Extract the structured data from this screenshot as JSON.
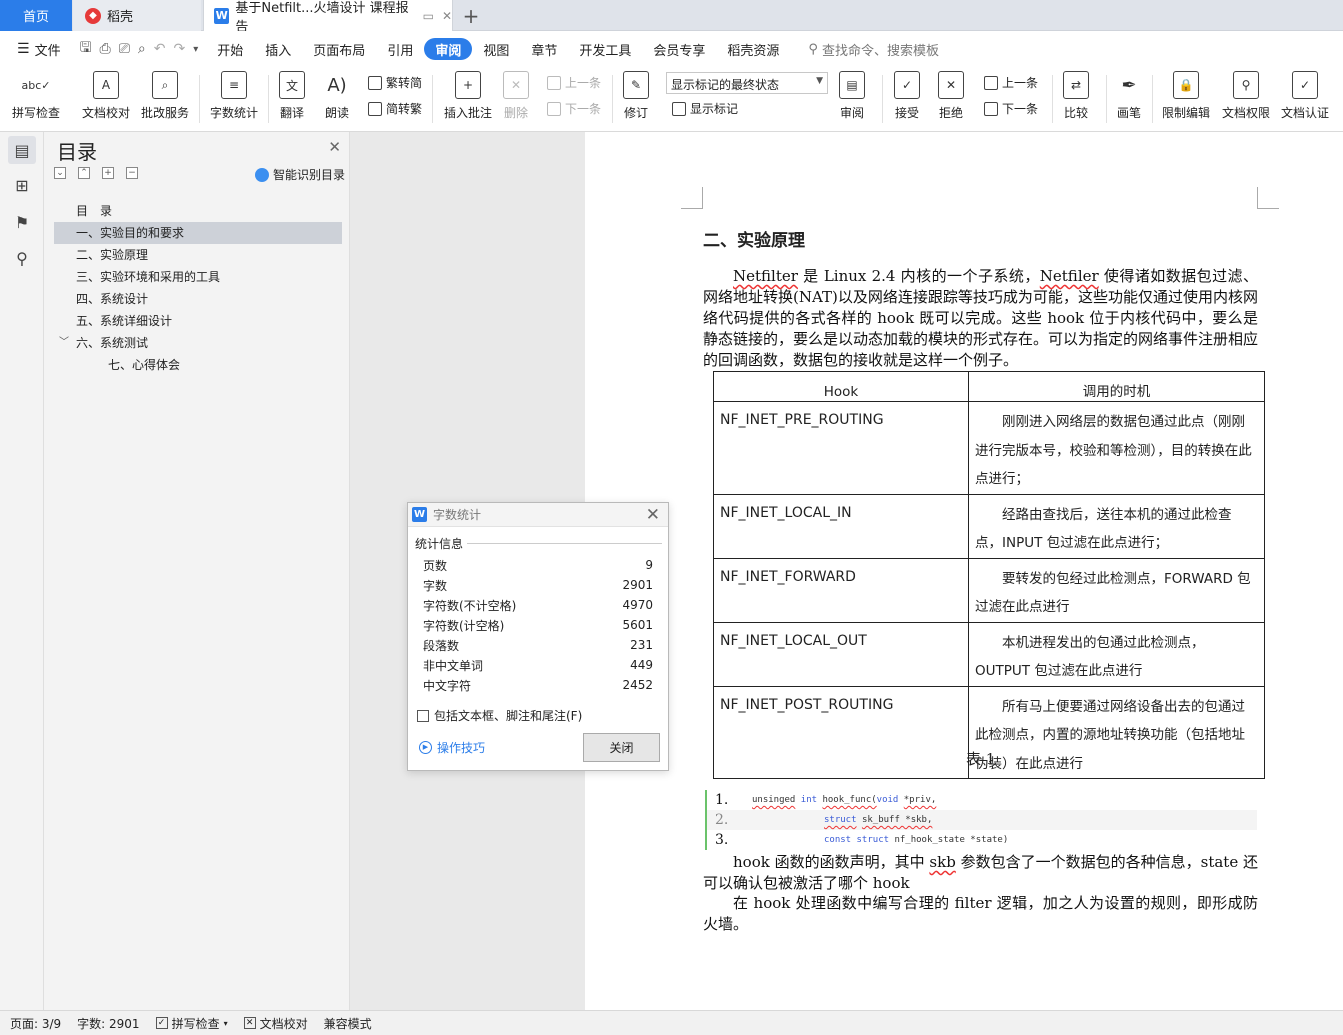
{
  "tabs": {
    "home": "首页",
    "docer": "稻壳",
    "doc": "基于Netfilt...火墙设计 课程报告",
    "add": "+"
  },
  "menu": {
    "file": "文件",
    "items": [
      "开始",
      "插入",
      "页面布局",
      "引用",
      "审阅",
      "视图",
      "章节",
      "开发工具",
      "会员专享",
      "稻壳资源"
    ],
    "active": "审阅",
    "search": "查找命令、搜索模板"
  },
  "ribbon": {
    "spellcheck": "拼写检查",
    "doccheck": "文档校对",
    "correction": "批改服务",
    "wordcount": "字数统计",
    "translate": "翻译",
    "readaloud": "朗读",
    "to_traditional": "繁转简",
    "to_simplified": "简转繁",
    "insert_comment": "插入批注",
    "delete": "删除",
    "prev_item": "上一条",
    "next_item": "下一条",
    "revise": "修订",
    "display_state": "显示标记的最终状态",
    "show_markup": "显示标记",
    "review": "审阅",
    "accept": "接受",
    "reject": "拒绝",
    "prev": "上一条",
    "next": "下一条",
    "compare": "比较",
    "pen": "画笔",
    "restrict_edit": "限制编辑",
    "doc_permission": "文档权限",
    "doc_cert": "文档认证"
  },
  "toc": {
    "title": "目录",
    "smart": "智能识别目录",
    "items": [
      {
        "label": "目　录"
      },
      {
        "label": "一、实验目的和要求"
      },
      {
        "label": "二、实验原理"
      },
      {
        "label": "三、实验环境和采用的工具"
      },
      {
        "label": "四、系统设计"
      },
      {
        "label": "五、系统详细设计"
      },
      {
        "label": "六、系统测试"
      },
      {
        "label": "七、心得体会"
      }
    ]
  },
  "document": {
    "heading": "二、实验原理",
    "p1_netfilter": "Netfilter",
    "p1_a": " 是 Linux 2.4 内核的一个子系统，",
    "p1_netfiler": "Netfiler",
    "p1_b": " 使得诸如数据包过滤、网络地址转换(NAT)以及网络连接跟踪等技巧成为可能，这些功能仅通过使用内核网络代码提供的各式各样的 hook 既可以完成。这些 hook 位于内核代码中，要么是静态链接的，要么是以动态加载的模块的形式存在。可以为指定的网络事件注册相应的回调函数，数据包的接收就是这样一个例子。",
    "table": {
      "headers": [
        "Hook",
        "调用的时机"
      ],
      "rows": [
        {
          "hook": "NF_INET_PRE_ROUTING",
          "desc": "刚刚进入网络层的数据包通过此点（刚刚进行完版本号，校验和等检测），目的转换在此点进行；"
        },
        {
          "hook": "NF_INET_LOCAL_IN",
          "desc": "经路由查找后，送往本机的通过此检查点，INPUT 包过滤在此点进行；"
        },
        {
          "hook": "NF_INET_FORWARD",
          "desc": "要转发的包经过此检测点，FORWARD 包过滤在此点进行"
        },
        {
          "hook": "NF_INET_LOCAL_OUT",
          "desc": "本机进程发出的包通过此检测点，OUTPUT 包过滤在此点进行"
        },
        {
          "hook": "NF_INET_POST_ROUTING",
          "desc": "所有马上便要通过网络设备出去的包通过此检测点，内置的源地址转换功能（包括地址伪装）在此点进行"
        }
      ]
    },
    "caption": "表 1",
    "code": {
      "n1": "1.",
      "n2": "2.",
      "n3": "3.",
      "l1_type": "unsinged",
      "l1_int": "int",
      "l1_fn": "hook_func(",
      "l1_void": "void",
      "l1_rest": "*priv,",
      "l2_struct": "struct",
      "l2_rest": "sk_buff *skb,",
      "l3_const": "const",
      "l3_struct": "struct",
      "l3_rest": "nf_hook_state *state)"
    },
    "p2_a": "hook 函数的函数声明，其中 ",
    "p2_skb": "skb",
    "p2_b": " 参数包含了一个数据包的各种信息，state 还可以确认包被激活了哪个 hook",
    "p3": "在 hook 处理函数中编写合理的 filter 逻辑，加之人为设置的规则，即形成防火墙。"
  },
  "dialog": {
    "title": "字数统计",
    "section": "统计信息",
    "stats": [
      {
        "label": "页数",
        "value": "9"
      },
      {
        "label": "字数",
        "value": "2901"
      },
      {
        "label": "字符数(不计空格)",
        "value": "4970"
      },
      {
        "label": "字符数(计空格)",
        "value": "5601"
      },
      {
        "label": "段落数",
        "value": "231"
      },
      {
        "label": "非中文单词",
        "value": "449"
      },
      {
        "label": "中文字符",
        "value": "2452"
      }
    ],
    "include": "包括文本框、脚注和尾注(F)",
    "tips": "操作技巧",
    "close": "关闭"
  },
  "status": {
    "page": "页面: 3/9",
    "words": "字数: 2901",
    "spell": "拼写检查",
    "proof": "文档校对",
    "compat": "兼容模式"
  }
}
